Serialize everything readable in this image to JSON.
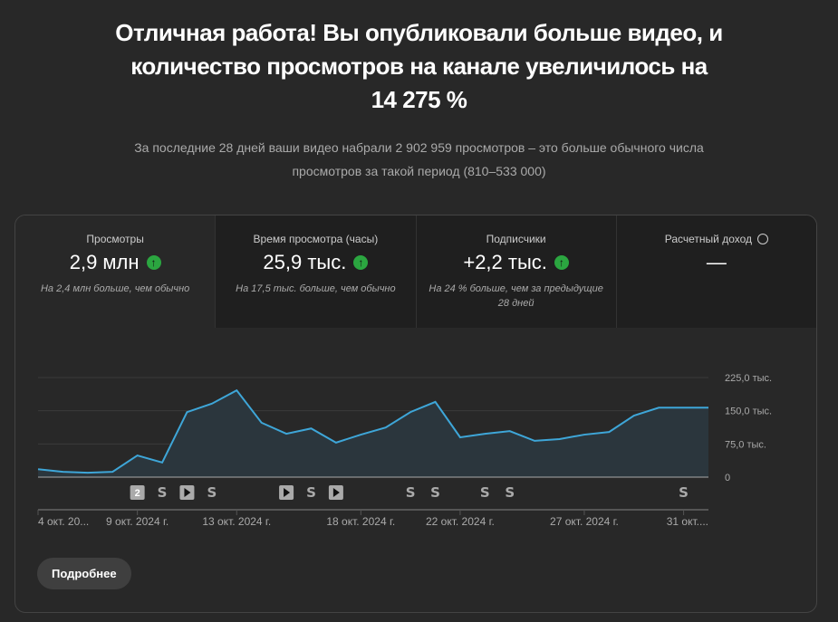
{
  "headline": [
    "Отличная работа! Вы опубликовали больше видео, и",
    "количество просмотров на канале увеличилось на",
    "14 275 %"
  ],
  "subtitle": [
    "За последние 28 дней ваши видео набрали 2 902 959 просмотров – это больше обычного числа",
    "просмотров за такой период (810–533 000)"
  ],
  "metrics": [
    {
      "label": "Просмотры",
      "value": "2,9 млн",
      "trend": "up",
      "note": "На 2,4 млн больше, чем обычно"
    },
    {
      "label": "Время просмотра (часы)",
      "value": "25,9 тыс.",
      "trend": "up",
      "note": "На 17,5 тыс. больше, чем обычно"
    },
    {
      "label": "Подписчики",
      "value": "+2,2 тыс.",
      "trend": "up",
      "note": "На 24 % больше, чем за предыдущие 28 дней"
    },
    {
      "label": "Расчетный доход",
      "value": "—",
      "icon": "clock-icon"
    }
  ],
  "more_button": "Подробнее",
  "chart_data": {
    "type": "area",
    "series": [
      {
        "name": "Просмотры",
        "color": "#3ea6d8",
        "values": [
          18000,
          12000,
          10000,
          12000,
          49000,
          33000,
          147000,
          166000,
          196000,
          123000,
          98000,
          110000,
          78000,
          96000,
          112000,
          147000,
          170000,
          90000,
          98000,
          104000,
          82000,
          86000,
          96000,
          102000,
          139000,
          157000,
          157000,
          157000
        ]
      }
    ],
    "ylim": [
      0,
      225000
    ],
    "yticks": [
      {
        "v": 0,
        "label": "0"
      },
      {
        "v": 75000,
        "label": "75,0 тыс."
      },
      {
        "v": 150000,
        "label": "150,0 тыс."
      },
      {
        "v": 225000,
        "label": "225,0 тыс."
      }
    ],
    "xticks": [
      {
        "i": 0,
        "label": "4 окт. 20..."
      },
      {
        "i": 4,
        "label": "9 окт. 2024 г."
      },
      {
        "i": 8,
        "label": "13 окт. 2024 г."
      },
      {
        "i": 13,
        "label": "18 окт. 2024 г."
      },
      {
        "i": 17,
        "label": "22 окт. 2024 г."
      },
      {
        "i": 22,
        "label": "27 окт. 2024 г."
      },
      {
        "i": 26,
        "label": "31 окт...."
      }
    ],
    "markers": [
      {
        "i": 4,
        "type": "count",
        "label": "2"
      },
      {
        "i": 5,
        "type": "short"
      },
      {
        "i": 6,
        "type": "video"
      },
      {
        "i": 7,
        "type": "short"
      },
      {
        "i": 10,
        "type": "video"
      },
      {
        "i": 11,
        "type": "short"
      },
      {
        "i": 12,
        "type": "video"
      },
      {
        "i": 15,
        "type": "short"
      },
      {
        "i": 16,
        "type": "short"
      },
      {
        "i": 18,
        "type": "short"
      },
      {
        "i": 19,
        "type": "short"
      },
      {
        "i": 26,
        "type": "short"
      }
    ]
  }
}
